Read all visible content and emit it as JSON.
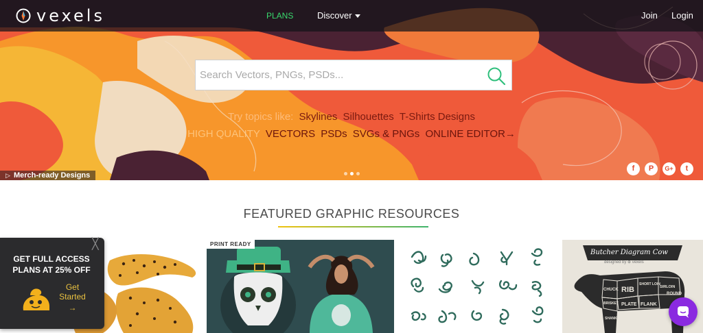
{
  "nav": {
    "brand": "vexels",
    "plans": "PLANS",
    "discover": "Discover",
    "join": "Join",
    "login": "Login"
  },
  "search": {
    "placeholder": "Search Vectors, PNGs, PSDs...",
    "value": ""
  },
  "topics": {
    "lead": "Try topics like:",
    "items": [
      "Skylines",
      "Silhouettes",
      "T-Shirts Designs"
    ]
  },
  "quality": {
    "lead": "HIGH QUALITY",
    "items": [
      "VECTORS",
      "PSDs",
      "SVGs & PNGs",
      "ONLINE EDITOR→"
    ]
  },
  "hero": {
    "merch_label": "Merch-ready Designs",
    "play_icon": "▷",
    "carousel_dots": 3,
    "carousel_active": 1,
    "socials": [
      {
        "name": "facebook",
        "glyph": "f"
      },
      {
        "name": "pinterest",
        "glyph": "P"
      },
      {
        "name": "google-plus",
        "glyph": "G+"
      },
      {
        "name": "twitter",
        "glyph": "t"
      }
    ]
  },
  "featured": {
    "title": "FEATURED GRAPHIC RESOURCES",
    "cards": [
      {
        "name": "leopards"
      },
      {
        "name": "skull-shirt",
        "badge": "PRINT READY"
      },
      {
        "name": "ornaments"
      },
      {
        "name": "butcher-diagram",
        "title": "Butcher Diagram Cow",
        "byline": "designed by ⊕ vexels",
        "cuts": [
          "RIB",
          "SHORT LOIN",
          "SIRLOIN",
          "ROUND",
          "CHUCK",
          "BRISKET",
          "PLATE",
          "FLANK",
          "SHANK"
        ]
      }
    ]
  },
  "promo": {
    "line1": "GET FULL ACCESS",
    "line2": "PLANS AT 25% OFF",
    "cta": "Get Started",
    "arrow": "→",
    "close": "╳"
  },
  "colors": {
    "plans_green": "#39d96d",
    "hero_orange": "#f7962b",
    "hero_red": "#ef5a3a",
    "hero_purple": "#4a2233",
    "promo_bg": "#2b2b2d",
    "chat_purple": "#8a2ae0"
  }
}
